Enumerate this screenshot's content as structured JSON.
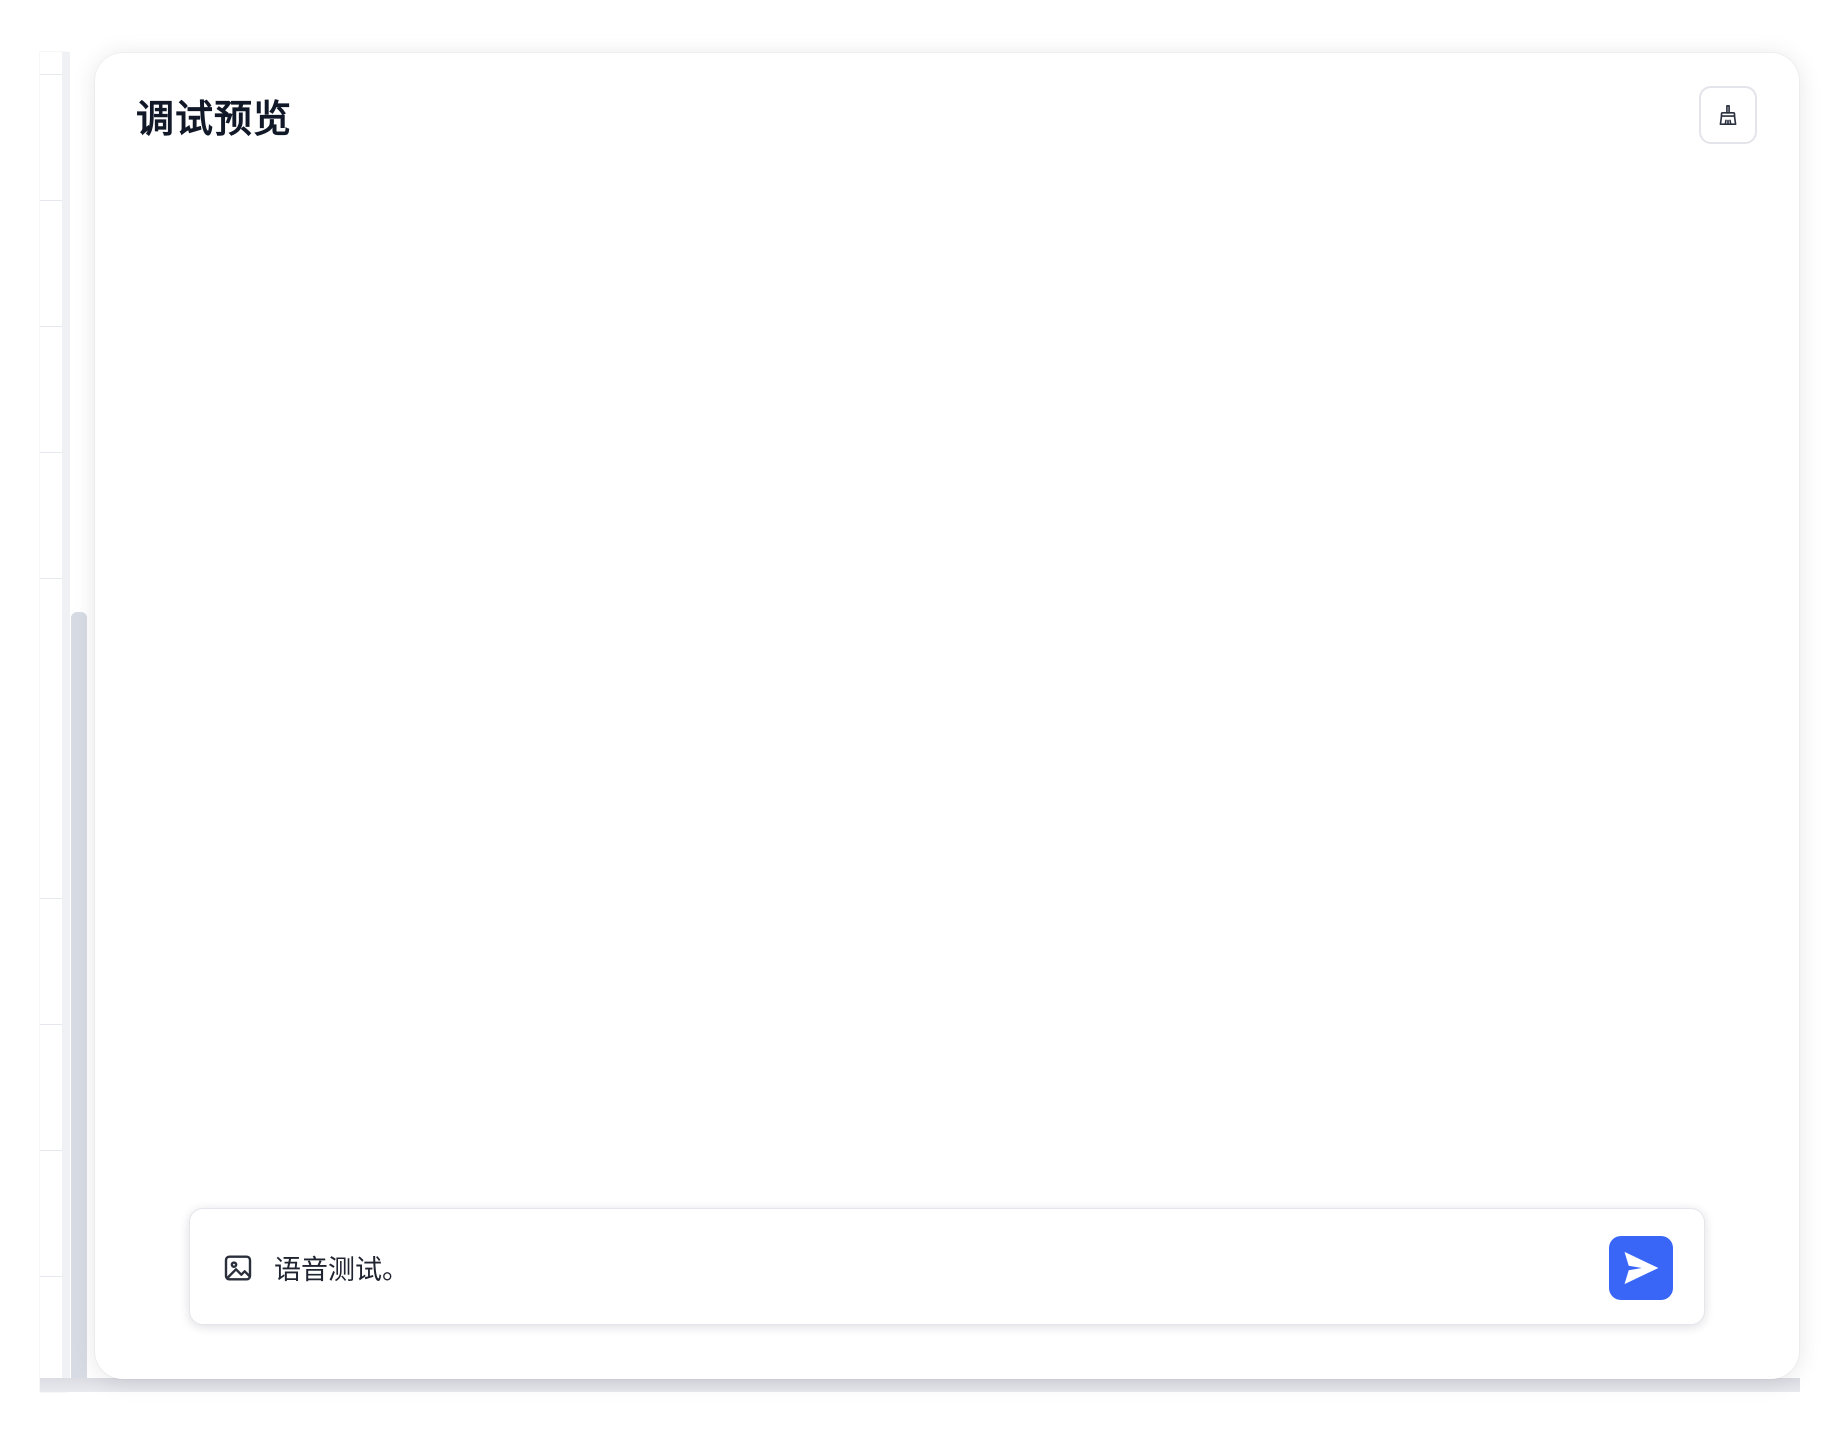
{
  "panel": {
    "title": "调试预览",
    "clear_button_icon": "broom-icon"
  },
  "input": {
    "value": "语音测试。",
    "image_button_icon": "image-icon",
    "send_button_icon": "send-icon"
  },
  "colors": {
    "accent": "#3a66f8",
    "title_text": "#111827",
    "border": "#e3e5ea"
  }
}
